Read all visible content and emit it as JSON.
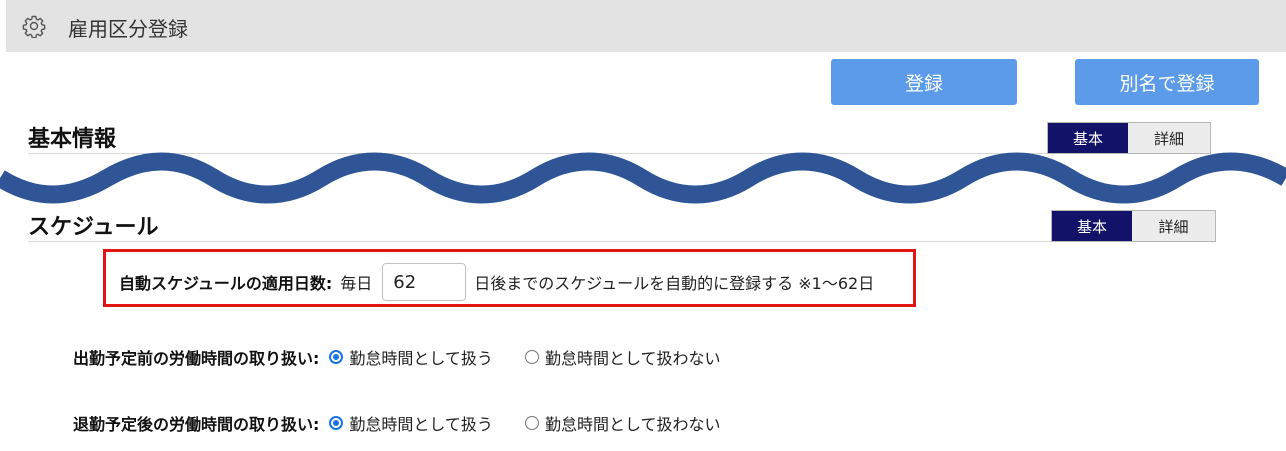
{
  "header": {
    "title": "雇用区分登録",
    "icon": "gear-icon"
  },
  "toolbar": {
    "save_label": "登録",
    "save_as_label": "別名で登録"
  },
  "sections": [
    {
      "title": "基本情報",
      "toggle": {
        "basic": "基本",
        "detail": "詳細",
        "selected": "基本"
      }
    },
    {
      "title": "スケジュール",
      "toggle": {
        "basic": "基本",
        "detail": "詳細",
        "selected": "基本"
      }
    }
  ],
  "schedule": {
    "auto_days_label": "自動スケジュールの適用日数:",
    "prefix": "毎日",
    "days_value": "62",
    "suffix": "日後までのスケジュールを自動的に登録する ※1～62日",
    "before_label": "出勤予定前の労働時間の取り扱い:",
    "after_label": "退勤予定後の労働時間の取り扱い:",
    "option_count": "勤怠時間として扱う",
    "option_not_count": "勤怠時間として扱わない",
    "before_selected": "勤怠時間として扱う",
    "after_selected": "勤怠時間として扱う"
  },
  "colors": {
    "accent": "#5b9bea",
    "toggle_active": "#121268",
    "highlight": "#e21414",
    "wave": "#2f5597",
    "radio": "#1a73e8"
  }
}
